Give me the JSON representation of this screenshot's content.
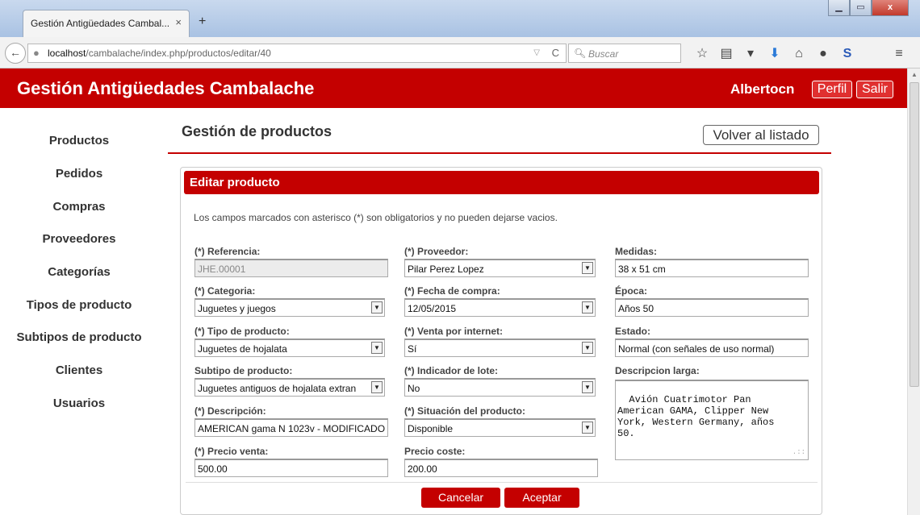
{
  "browser": {
    "tab_title": "Gestión Antigüedades Cambal...",
    "tab_close": "×",
    "new_tab": "+",
    "url_host": "localhost",
    "url_path": "/cambalache/index.php/productos/editar/40",
    "search_placeholder": "Buscar",
    "win_min": "▁",
    "win_max": "▭",
    "win_close": "x"
  },
  "header": {
    "site_title": "Gestión Antigüedades Cambalache",
    "user": "Albertocn",
    "profile": "Perfil",
    "logout": "Salir"
  },
  "sidebar": {
    "items": [
      "Productos",
      "Pedidos",
      "Compras",
      "Proveedores",
      "Categorías",
      "Tipos de producto",
      "Subtipos de producto",
      "Clientes",
      "Usuarios"
    ]
  },
  "page": {
    "title": "Gestión de productos",
    "back_button": "Volver al listado"
  },
  "panel": {
    "title": "Editar producto",
    "notice": "Los campos marcados con asterisco (*) son obligatorios y no pueden dejarse vacios."
  },
  "form": {
    "referencia": {
      "label": "(*) Referencia:",
      "value": "JHE.00001"
    },
    "categoria": {
      "label": "(*) Categoria:",
      "value": "Juguetes y juegos"
    },
    "tipo": {
      "label": "(*) Tipo de producto:",
      "value": "Juguetes de hojalata"
    },
    "subtipo": {
      "label": "Subtipo de producto:",
      "value": "Juguetes antiguos de hojalata extran"
    },
    "descripcion": {
      "label": "(*) Descripción:",
      "value": "AMERICAN gama N 1023v - MODIFICADO"
    },
    "precio_venta": {
      "label": "(*) Precio venta:",
      "value": "500.00"
    },
    "proveedor": {
      "label": "(*) Proveedor:",
      "value": "Pilar Perez Lopez"
    },
    "fecha_compra": {
      "label": "(*) Fecha de compra:",
      "value": "12/05/2015"
    },
    "venta_internet": {
      "label": "(*) Venta por internet:",
      "value": "Sí"
    },
    "indicador_lote": {
      "label": "(*) Indicador de lote:",
      "value": "No"
    },
    "situacion": {
      "label": "(*) Situación del producto:",
      "value": "Disponible"
    },
    "precio_coste": {
      "label": "Precio coste:",
      "value": "200.00"
    },
    "medidas": {
      "label": "Medidas:",
      "value": "38 x 51 cm"
    },
    "epoca": {
      "label": "Época:",
      "value": "Años 50"
    },
    "estado": {
      "label": "Estado:",
      "value": "Normal (con señales de uso normal)"
    },
    "descripcion_larga": {
      "label": "Descripcion larga:",
      "value": "Avión Cuatrimotor Pan\nAmerican GAMA, Clipper New\nYork, Western Germany, años\n50."
    }
  },
  "actions": {
    "cancel": "Cancelar",
    "accept": "Aceptar"
  },
  "colors": {
    "brand_red": "#c40000"
  }
}
